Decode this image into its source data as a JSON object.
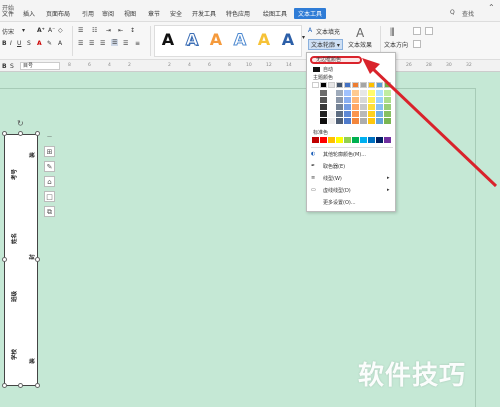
{
  "menubar": {
    "items": [
      "文件",
      "插入",
      "页面布局",
      "引用",
      "审阅",
      "视图",
      "章节",
      "安全",
      "开发工具",
      "特色应用",
      "绘图工具",
      "文本工具"
    ],
    "active": "文本工具",
    "left_label": "开始",
    "right_icons": [
      "Q",
      "查找"
    ]
  },
  "ribbon": {
    "font_label": "仿宋",
    "wordart_letters": [
      "A",
      "A",
      "A",
      "A",
      "A",
      "A"
    ],
    "text_fill": "文本填充",
    "text_outline": "文本轮廓",
    "text_effect": "文本效果",
    "text_direction": "文本方向"
  },
  "ruler": {
    "para_label": "B",
    "style_label": "S",
    "style_value": "目号",
    "ticks": [
      "8",
      "6",
      "4",
      "2",
      "2",
      "4",
      "6",
      "8",
      "10",
      "12",
      "14",
      "16",
      "18",
      "20",
      "22",
      "24",
      "26",
      "28",
      "30",
      "32"
    ]
  },
  "textbox": {
    "col1": [
      "考号",
      "姓名",
      "班级",
      "学校"
    ],
    "col2": [
      "装",
      "封",
      "线",
      "装"
    ]
  },
  "dropdown": {
    "top_item": "无边框颜色",
    "auto": "自动",
    "theme_colors": "主题颜色",
    "standard_colors": "标准色",
    "more_colors": "其他轮廓颜色(M)...",
    "eyedropper": "取色器(E)",
    "line_style": "线型(W)",
    "dash_style": "虚线线型(D)",
    "more_settings": "更多设置(O)..."
  },
  "colors": {
    "accent": "#2f7cd6",
    "page_bg": "#c5e8d5",
    "arrow": "#d9232b"
  },
  "watermark": "软件技巧"
}
